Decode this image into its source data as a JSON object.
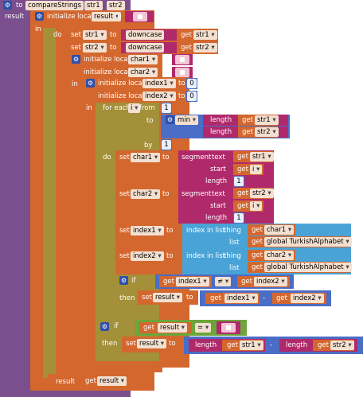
{
  "procedure": {
    "keyword": "to",
    "name": "compareStrings",
    "params": [
      "str1",
      "str2"
    ],
    "result_label": "result"
  },
  "init_result": {
    "label": "initialize local",
    "var": "result",
    "to": "to"
  },
  "in_label": "in",
  "do_label": "do",
  "set_label": "set",
  "to_label": "to",
  "get_label": "get",
  "downcase": "downcase",
  "init_char": {
    "label": "initialize local",
    "var1": "char1",
    "var2": "char2",
    "to": "to"
  },
  "init_index": {
    "label": "initialize local",
    "var1": "index1",
    "var2": "index2",
    "to": "to",
    "value1": "0",
    "value2": "0"
  },
  "foreach": {
    "label": "for each",
    "var": "i",
    "from": "from",
    "to": "to",
    "by": "by",
    "from_val": "1",
    "by_val": "1",
    "min": "min",
    "length": "length"
  },
  "segment": {
    "label": "segment",
    "text": "text",
    "start": "start",
    "length": "length",
    "length_val": "1"
  },
  "index_in_list": {
    "label": "index in list",
    "thing": "thing",
    "list": "list",
    "list_var": "global TurkishAlphabet"
  },
  "if_label": "if",
  "then_label": "then",
  "neq": "≠",
  "eq": "=",
  "minus": "-",
  "vars": {
    "str1": "str1",
    "str2": "str2",
    "char1": "char1",
    "char2": "char2",
    "index1": "index1",
    "index2": "index2",
    "i": "i",
    "result": "result"
  },
  "result_return": {
    "label": "result",
    "get": "get",
    "var": "result"
  }
}
